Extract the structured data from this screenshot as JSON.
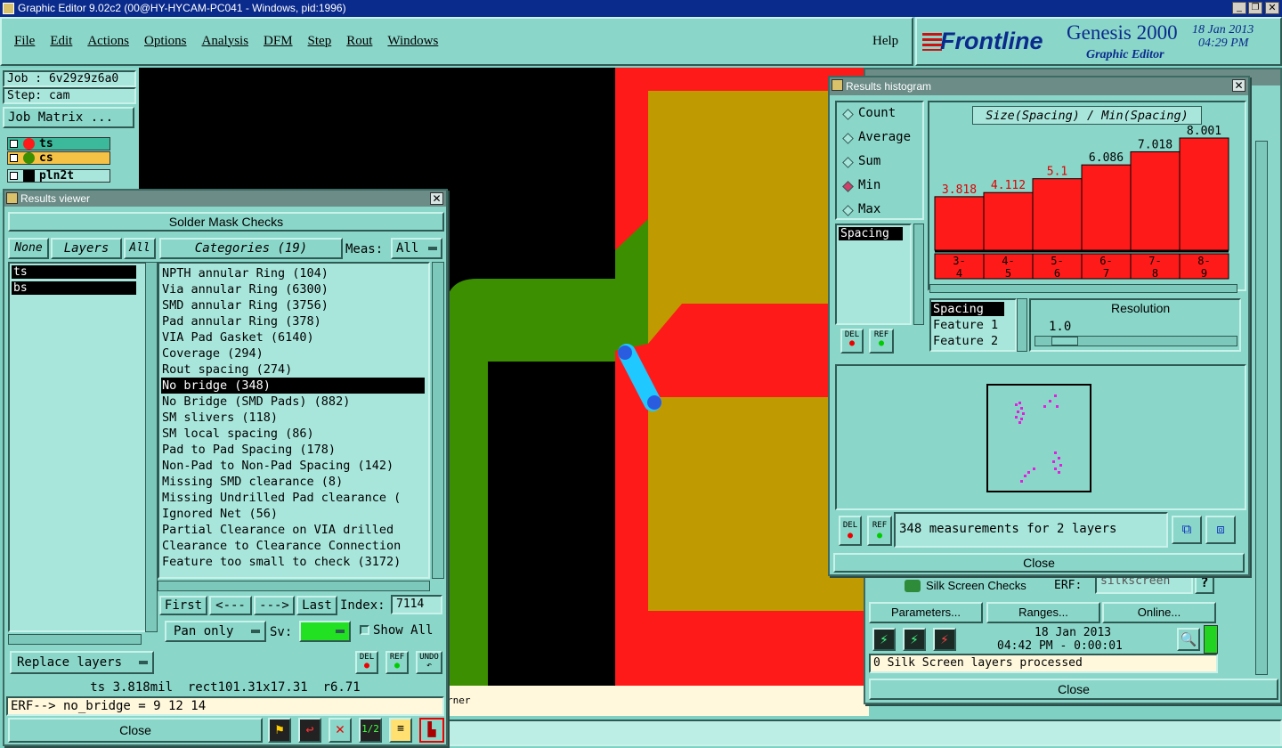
{
  "app": {
    "title": "Graphic Editor 9.02c2 (00@HY-HYCAM-PC041 - Windows, pid:1996)"
  },
  "menu": [
    "File",
    "Edit",
    "Actions",
    "Options",
    "Analysis",
    "DFM",
    "Step",
    "Rout",
    "Windows"
  ],
  "help": "Help",
  "brand": {
    "logo": "Frontline",
    "product": "Genesis 2000",
    "subtitle": "Graphic Editor",
    "date": "18 Jan 2013",
    "time": "04:29 PM"
  },
  "job": {
    "job": "Job : 6v29z9z6a0",
    "step": "Step: cam",
    "matrix": "Job Matrix ..."
  },
  "layers": [
    "ts",
    "cs",
    "pln2t"
  ],
  "canvas": {
    "bg": "#000000",
    "red": "#ff1a1a",
    "gold": "#bf9a00",
    "green": "#3c8f00"
  },
  "results_viewer": {
    "title": "Results viewer",
    "header": "Solder Mask Checks",
    "none": "None",
    "layers_btn": "Layers",
    "all": "All",
    "categories": "Categories (19)",
    "meas": "Meas:",
    "meas_val": "All",
    "layer_list": [
      "ts",
      "bs"
    ],
    "items": [
      "NPTH annular Ring (104)",
      "Via annular Ring (6300)",
      "SMD annular Ring (3756)",
      "Pad annular Ring (378)",
      "VIA Pad Gasket (6140)",
      "Coverage (294)",
      "Rout spacing (274)",
      "No bridge (348)",
      "No Bridge (SMD Pads) (882)",
      "SM slivers (118)",
      "SM local spacing (86)",
      "Pad to Pad Spacing (178)",
      "Non-Pad to Non-Pad Spacing (142)",
      "Missing SMD clearance (8)",
      "Missing Undrilled Pad clearance (",
      "Ignored Net (56)",
      "Partial Clearance on VIA drilled",
      "Clearance to Clearance Connection",
      "Feature too small to check (3172)"
    ],
    "selected": "No bridge (348)",
    "first": "First",
    "prev": "<---",
    "next": "--->",
    "last": "Last",
    "index_lbl": "Index:",
    "index": "7114",
    "pan": "Pan only",
    "sv": "Sv:",
    "show_all": "Show All",
    "replace": "Replace layers",
    "del": "DEL",
    "ref": "REF",
    "undo": "UNDO",
    "status": "ts 3.818mil  rect101.31x17.31  r6.71",
    "erf": "ERF--> no_bridge = 9 12 14",
    "close": "Close"
  },
  "bottom_text": "rner",
  "histogram": {
    "title": "Results histogram",
    "options": [
      "Count",
      "Average",
      "Sum",
      "Min",
      "Max"
    ],
    "selected": "Min",
    "chart_title": "Size(Spacing) / Min(Spacing)",
    "list": [
      "Spacing"
    ],
    "prop_list": [
      "Spacing",
      "Feature 1",
      "Feature 2"
    ],
    "resolution_lbl": "Resolution",
    "resolution": "1.0",
    "status": "348 measurements for 2 layers",
    "close": "Close",
    "del": "DEL",
    "ref": "REF"
  },
  "chart_data": {
    "type": "bar",
    "title": "Size(Spacing) / Min(Spacing)",
    "categories": [
      "3-4",
      "4-5",
      "5-6",
      "6-7",
      "7-8",
      "8-9"
    ],
    "cat_top": [
      "3-",
      "4-",
      "5-",
      "6-",
      "7-",
      "8-"
    ],
    "cat_bottom": [
      "4",
      "5",
      "6",
      "7",
      "8",
      "9"
    ],
    "values": [
      3.818,
      4.112,
      5.1,
      6.086,
      7.018,
      8.001
    ],
    "labels": [
      "3.818",
      "4.112",
      "5.1",
      "6.086",
      "7.018",
      "8.001"
    ],
    "label_colors": [
      "#e00000",
      "#e00000",
      "#e00000",
      "#000000",
      "#000000",
      "#000000"
    ],
    "bar_color": "#ff1a1a",
    "ylim": [
      0,
      8.001
    ]
  },
  "silk": {
    "title": "Silk Screen Checks",
    "erf": "ERF:",
    "erf_val": "silkscreen",
    "q": "?",
    "params": "Parameters...",
    "ranges": "Ranges...",
    "online": "Online...",
    "date": "18 Jan 2013",
    "time": "04:42 PM - 0:00:01",
    "msg": "0 Silk Screen layers processed",
    "close": "Close"
  }
}
